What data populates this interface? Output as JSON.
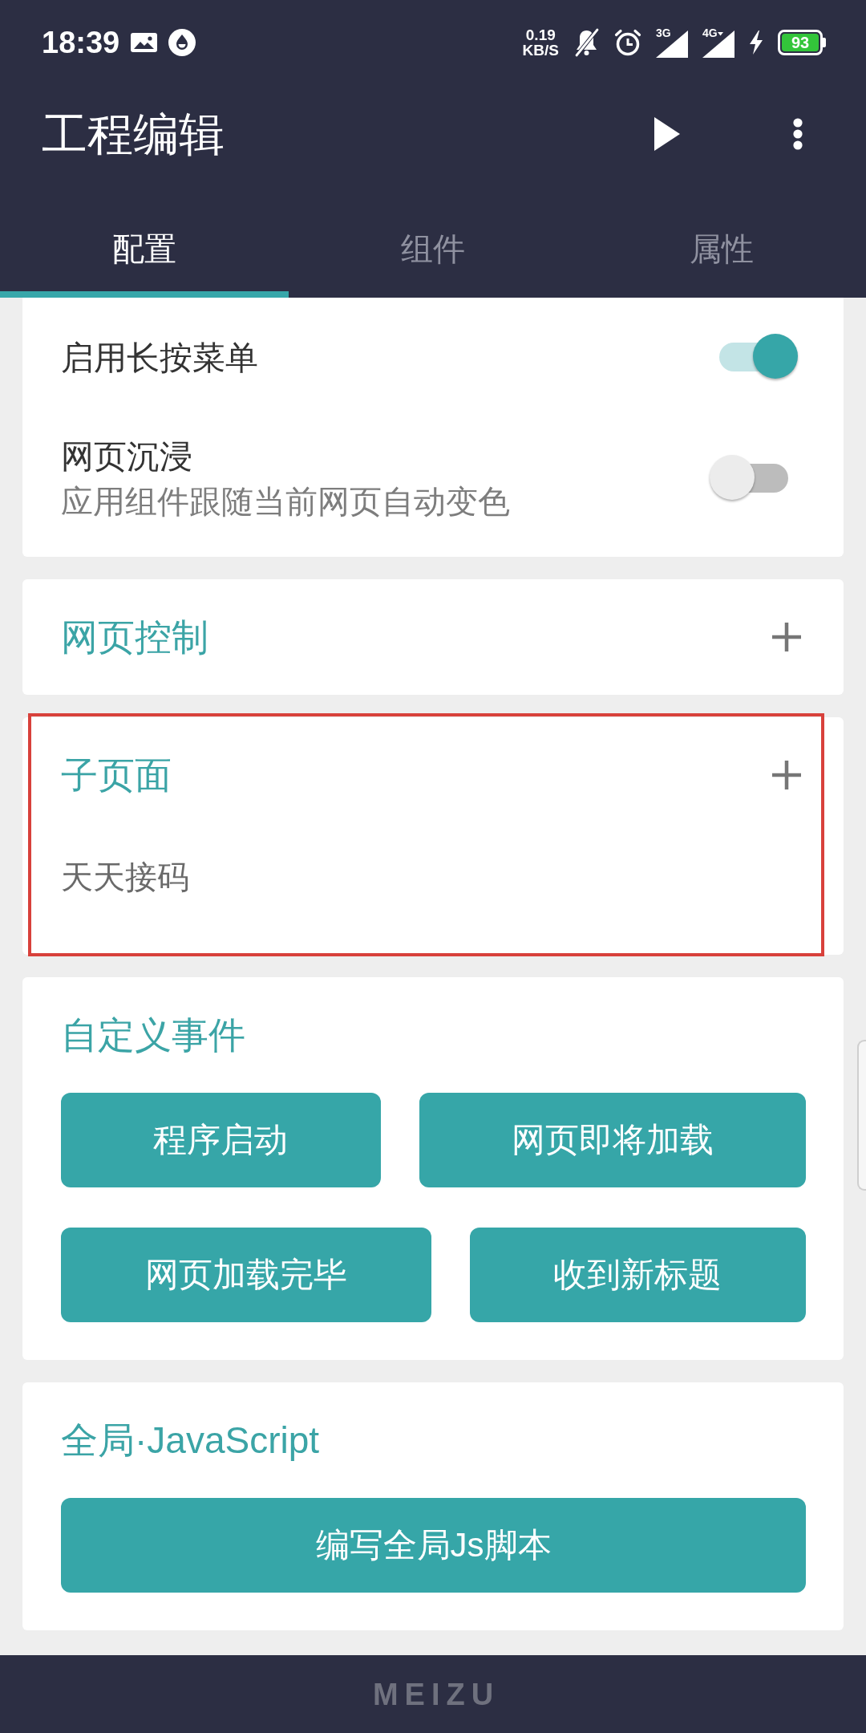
{
  "status_bar": {
    "time": "18:39",
    "net_speed": "0.19",
    "net_speed_unit": "KB/S",
    "signals": [
      {
        "label": "3G",
        "data_arrow": false
      },
      {
        "label": "4G",
        "data_arrow": true
      }
    ],
    "charging": true,
    "battery": "93"
  },
  "app_bar": {
    "title": "工程编辑"
  },
  "tabs": [
    {
      "label": "配置",
      "selected": true
    },
    {
      "label": "组件",
      "selected": false
    },
    {
      "label": "属性",
      "selected": false
    }
  ],
  "sections": [
    {
      "kind": "toggles",
      "highlighted": false,
      "items": [
        {
          "title": "启用长按菜单",
          "on": true
        },
        {
          "title": "网页沉浸",
          "subtitle": "应用组件跟随当前网页自动变色",
          "on": false
        }
      ]
    },
    {
      "kind": "list",
      "title": "网页控制",
      "highlighted": false
    },
    {
      "kind": "list",
      "title": "子页面",
      "highlighted": true,
      "items": [
        "天天接码"
      ]
    },
    {
      "kind": "buttons",
      "title": "自定义事件",
      "highlighted": false,
      "rows": [
        [
          "程序启动",
          "网页即将加载"
        ],
        [
          "网页加载完毕",
          "收到新标题"
        ]
      ]
    },
    {
      "kind": "buttons",
      "title": "全局·JavaScript",
      "highlighted": false,
      "rows": [
        [
          "编写全局Js脚本"
        ]
      ]
    }
  ],
  "nav_bar": {
    "brand": "MEIZU"
  }
}
